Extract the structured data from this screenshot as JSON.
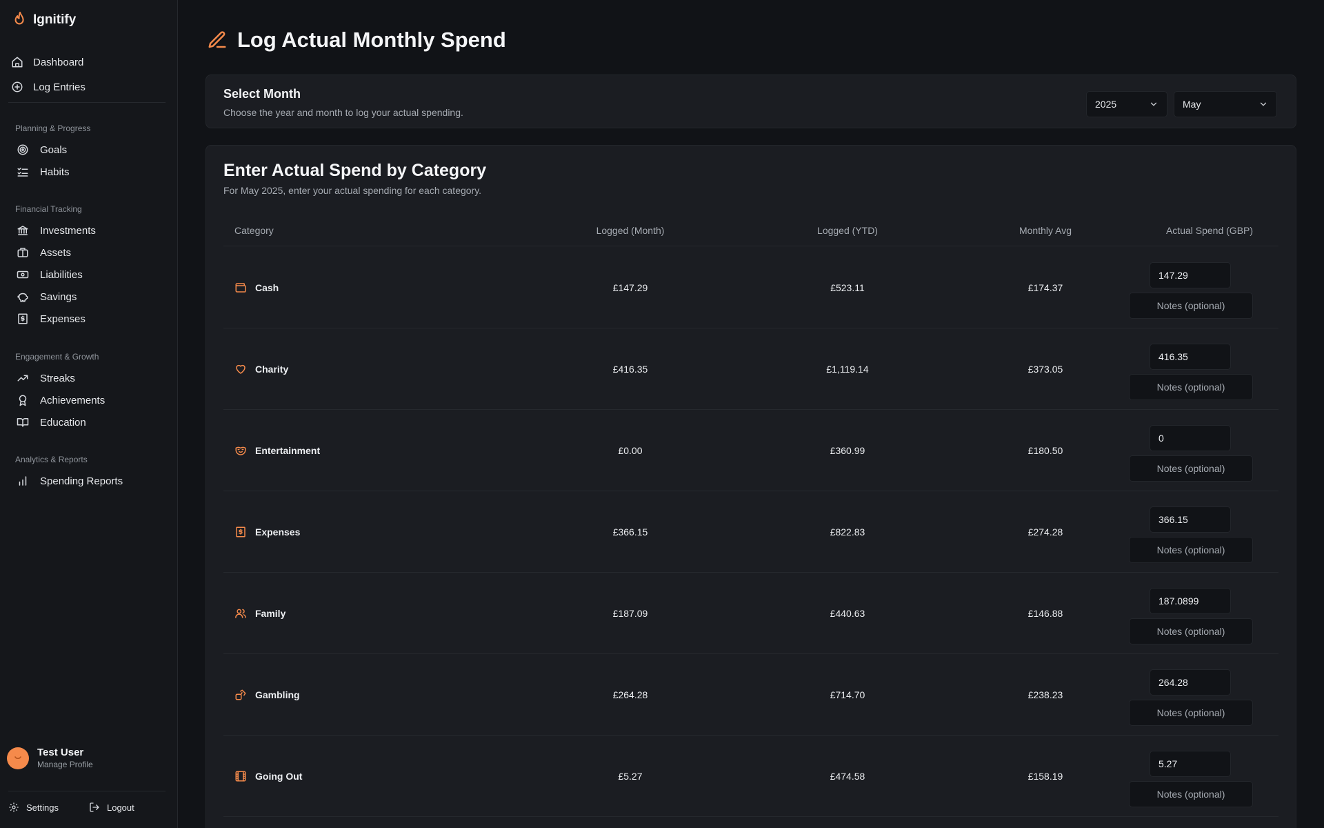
{
  "app": {
    "name": "Ignitify"
  },
  "colors": {
    "accent": "#f58a4b",
    "background": "#111317",
    "card": "#1b1d22"
  },
  "sidebar": {
    "top_items": [
      {
        "label": "Dashboard",
        "icon": "home-icon"
      },
      {
        "label": "Log Entries",
        "icon": "plus-circle-icon"
      }
    ],
    "sections": [
      {
        "label": "Planning & Progress",
        "items": [
          {
            "label": "Goals",
            "icon": "target-icon"
          },
          {
            "label": "Habits",
            "icon": "checklist-icon"
          }
        ]
      },
      {
        "label": "Financial Tracking",
        "items": [
          {
            "label": "Investments",
            "icon": "bank-icon"
          },
          {
            "label": "Assets",
            "icon": "briefcase-icon"
          },
          {
            "label": "Liabilities",
            "icon": "banknote-icon"
          },
          {
            "label": "Savings",
            "icon": "piggy-bank-icon"
          },
          {
            "label": "Expenses",
            "icon": "receipt-icon"
          }
        ]
      },
      {
        "label": "Engagement & Growth",
        "items": [
          {
            "label": "Streaks",
            "icon": "trending-up-icon"
          },
          {
            "label": "Achievements",
            "icon": "award-icon"
          },
          {
            "label": "Education",
            "icon": "book-icon"
          }
        ]
      },
      {
        "label": "Analytics & Reports",
        "items": [
          {
            "label": "Spending Reports",
            "icon": "bar-chart-icon"
          }
        ]
      }
    ],
    "profile": {
      "name": "Test User",
      "subtitle": "Manage Profile"
    },
    "bottom": {
      "settings_label": "Settings",
      "logout_label": "Logout"
    }
  },
  "page": {
    "title": "Log Actual Monthly Spend",
    "select_month": {
      "title": "Select Month",
      "subtitle": "Choose the year and month to log your actual spending.",
      "year": "2025",
      "month": "May"
    },
    "spend": {
      "title": "Enter Actual Spend by Category",
      "subtitle": "For May 2025, enter your actual spending for each category.",
      "columns": {
        "category": "Category",
        "logged_month": "Logged (Month)",
        "logged_ytd": "Logged (YTD)",
        "monthly_avg": "Monthly Avg",
        "actual_spend": "Actual Spend (GBP)"
      },
      "notes_placeholder": "Notes (optional)",
      "rows": [
        {
          "category": "Cash",
          "icon": "wallet-icon",
          "logged_month": "£147.29",
          "logged_ytd": "£523.11",
          "monthly_avg": "£174.37",
          "actual": "147.29"
        },
        {
          "category": "Charity",
          "icon": "heart-icon",
          "logged_month": "£416.35",
          "logged_ytd": "£1,119.14",
          "monthly_avg": "£373.05",
          "actual": "416.35"
        },
        {
          "category": "Entertainment",
          "icon": "drama-mask-icon",
          "logged_month": "£0.00",
          "logged_ytd": "£360.99",
          "monthly_avg": "£180.50",
          "actual": "0"
        },
        {
          "category": "Expenses",
          "icon": "receipt-icon",
          "logged_month": "£366.15",
          "logged_ytd": "£822.83",
          "monthly_avg": "£274.28",
          "actual": "366.15"
        },
        {
          "category": "Family",
          "icon": "users-icon",
          "logged_month": "£187.09",
          "logged_ytd": "£440.63",
          "monthly_avg": "£146.88",
          "actual": "187.0899"
        },
        {
          "category": "Gambling",
          "icon": "dice-icon",
          "logged_month": "£264.28",
          "logged_ytd": "£714.70",
          "monthly_avg": "£238.23",
          "actual": "264.28"
        },
        {
          "category": "Going Out",
          "icon": "film-icon",
          "logged_month": "£5.27",
          "logged_ytd": "£474.58",
          "monthly_avg": "£158.19",
          "actual": "5.27"
        }
      ]
    }
  }
}
